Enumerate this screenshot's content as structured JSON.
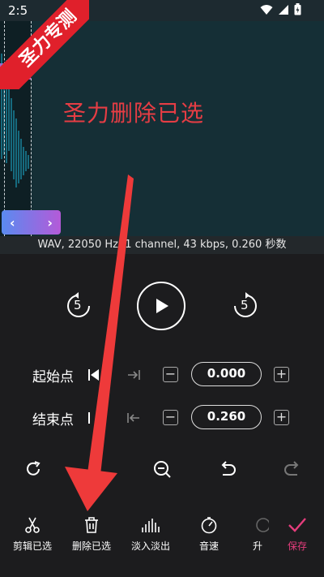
{
  "status_bar": {
    "time": "2:5"
  },
  "corner_badge": "圣力专测",
  "editor": {
    "overlay_text": "圣力删除已选"
  },
  "info_bar": "WAV, 22050 Hz, 1 channel, 43 kbps, 0.260 秒数",
  "start_point": {
    "label": "起始点",
    "value": "0.000"
  },
  "end_point": {
    "label": "结束点",
    "value": "0.260"
  },
  "skip_back_label": "5",
  "skip_forward_label": "5",
  "bottom_bar": {
    "cut": "剪辑已选",
    "delete": "删除已选",
    "fade": "淡入淡出",
    "speed": "音速",
    "pitch": "升",
    "save": "保存"
  },
  "colors": {
    "accent_pink": "#e53d7c",
    "annotation_red": "#ee3a3a",
    "editor_bg": "#152f36"
  }
}
